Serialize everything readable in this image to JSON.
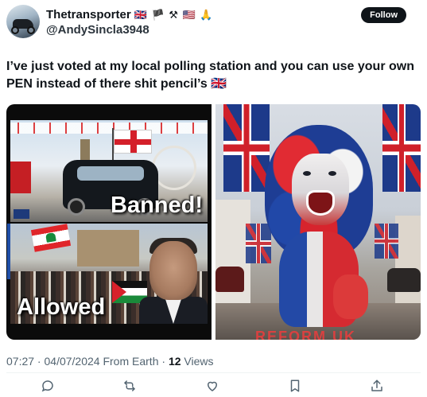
{
  "author": {
    "display_name": "Thetransporter",
    "name_emojis": "🇬🇧 🏴 ⚒ 🇺🇸 🙏",
    "handle": "@AndySincla3948"
  },
  "follow_button": {
    "label": "Follow"
  },
  "tweet": {
    "text": "I’ve just voted at my local polling station and you can use your own PEN instead of there shit pencil’s 🇬🇧"
  },
  "media": {
    "left_image": {
      "top_caption": "Banned!",
      "bottom_caption": "Allowed"
    },
    "right_image": {
      "partial_text": "REFORM UK"
    }
  },
  "meta": {
    "time": "07:27",
    "separator1": " · ",
    "date": "04/07/2024",
    "location": " From Earth",
    "separator2": " · ",
    "views_count": "12",
    "views_label": " Views"
  },
  "actions": {
    "icons": [
      "reply-icon",
      "retweet-icon",
      "like-icon",
      "bookmark-icon",
      "share-icon"
    ]
  }
}
